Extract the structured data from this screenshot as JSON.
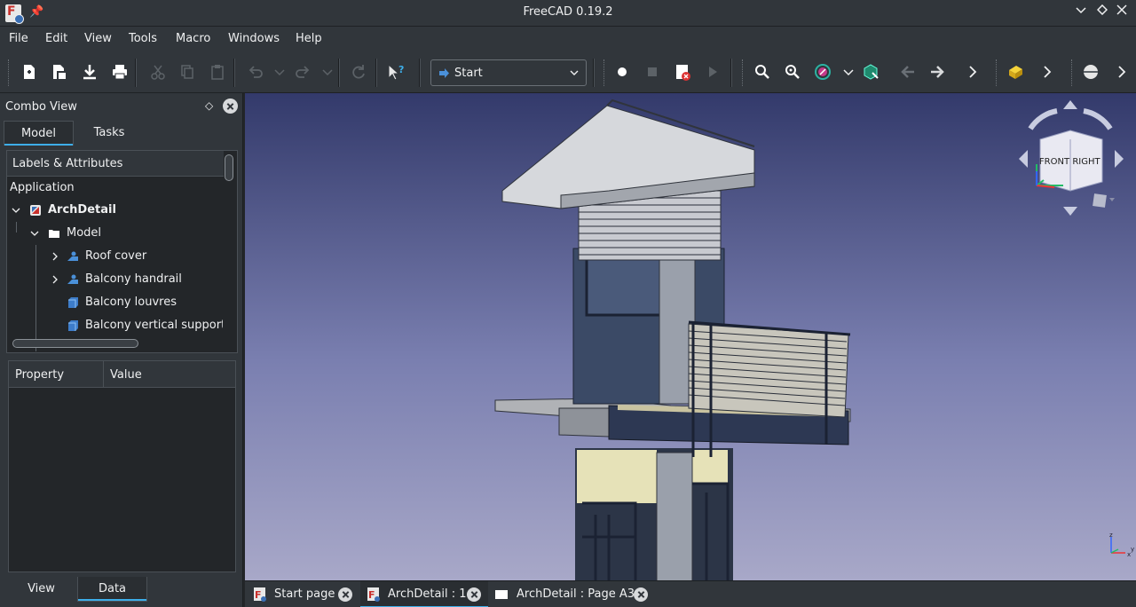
{
  "window": {
    "title": "FreeCAD 0.19.2"
  },
  "menu": [
    "File",
    "Edit",
    "View",
    "Tools",
    "Macro",
    "Windows",
    "Help"
  ],
  "toolbar": {
    "workbench": "Start",
    "icons": [
      "new-icon",
      "open-icon",
      "save-icon",
      "print-icon",
      "cut-icon",
      "copy-icon",
      "paste-icon",
      "undo-icon",
      "redo-icon",
      "refresh-icon",
      "whats-this-icon",
      "record-macro-icon",
      "stop-macro-icon",
      "macros-icon",
      "execute-macro-icon",
      "fit-all-icon",
      "fit-selection-icon",
      "draw-style-icon",
      "std-views-icon",
      "back-icon",
      "forward-icon",
      "more-icon",
      "part-box-icon",
      "sphere-icon"
    ]
  },
  "combo_view": {
    "title": "Combo View",
    "tabs": [
      "Model",
      "Tasks"
    ],
    "active_tab": "Model",
    "tree_header": "Labels & Attributes",
    "tree": {
      "root": "Application",
      "document": "ArchDetail",
      "group": "Model",
      "items": [
        "Roof cover",
        "Balcony handrail",
        "Balcony louvres",
        "Balcony vertical support"
      ]
    },
    "property_columns": [
      "Property",
      "Value"
    ],
    "bottom_tabs": [
      "View",
      "Data"
    ],
    "active_bottom_tab": "Data"
  },
  "navcube": {
    "front": "FRONT",
    "right": "RIGHT"
  },
  "doc_tabs": [
    {
      "label": "Start page",
      "active": false
    },
    {
      "label": "ArchDetail : 1",
      "active": true
    },
    {
      "label": "ArchDetail : Page A3",
      "active": false
    }
  ],
  "colors": {
    "accent": "#3daee9",
    "panel": "#31363b",
    "viewport_top": "#333a6b",
    "viewport_bottom": "#a8a8c8"
  }
}
